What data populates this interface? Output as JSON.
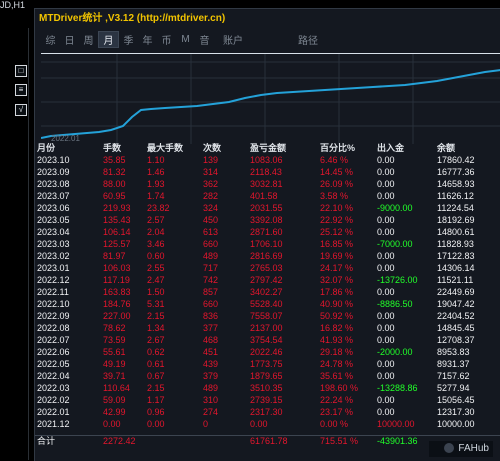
{
  "top": {
    "left_label": "JD,H1"
  },
  "window": {
    "title": "MTDriver统计 ,V3.12 (http://mtdriver.cn)",
    "tabs": [
      "综",
      "日",
      "周",
      "月",
      "季",
      "年",
      "币",
      "M",
      "音",
      "账户",
      "路径"
    ],
    "active_tab": "月"
  },
  "chart_label": {
    "date": "2022.01"
  },
  "table": {
    "headers": [
      "月份",
      "手数",
      "最大手数",
      "次数",
      "盈亏金额",
      "百分比%",
      "出入金",
      "余额"
    ],
    "rows": [
      [
        "2023.10",
        "35.85",
        "1.10",
        "139",
        "1083.06",
        "6.46 %",
        "0.00",
        "17860.42"
      ],
      [
        "2023.09",
        "81.32",
        "1.46",
        "314",
        "2118.43",
        "14.45 %",
        "0.00",
        "16777.36"
      ],
      [
        "2023.08",
        "88.00",
        "1.93",
        "362",
        "3032.81",
        "26.09 %",
        "0.00",
        "14658.93"
      ],
      [
        "2023.07",
        "60.95",
        "1.74",
        "282",
        "401.58",
        "3.58 %",
        "0.00",
        "11626.12"
      ],
      [
        "2023.06",
        "219.93",
        "23.82",
        "324",
        "2031.55",
        "22.10 %",
        "-9000.00",
        "11224.54"
      ],
      [
        "2023.05",
        "135.43",
        "2.57",
        "450",
        "3392.08",
        "22.92 %",
        "0.00",
        "18192.69"
      ],
      [
        "2023.04",
        "106.14",
        "2.04",
        "613",
        "2871.60",
        "25.12 %",
        "0.00",
        "14800.61"
      ],
      [
        "2023.03",
        "125.57",
        "3.46",
        "660",
        "1706.10",
        "16.85 %",
        "-7000.00",
        "11828.93"
      ],
      [
        "2023.02",
        "81.97",
        "0.60",
        "489",
        "2816.69",
        "19.69 %",
        "0.00",
        "17122.83"
      ],
      [
        "2023.01",
        "106.03",
        "2.55",
        "717",
        "2765.03",
        "24.17 %",
        "0.00",
        "14306.14"
      ],
      [
        "2022.12",
        "117.19",
        "2.47",
        "742",
        "2797.42",
        "32.07 %",
        "-13726.00",
        "11521.11"
      ],
      [
        "2022.11",
        "163.83",
        "1.50",
        "857",
        "3402.27",
        "17.86 %",
        "0.00",
        "22449.69"
      ],
      [
        "2022.10",
        "184.76",
        "5.31",
        "660",
        "5528.40",
        "40.90 %",
        "-8886.50",
        "19047.42"
      ],
      [
        "2022.09",
        "227.00",
        "2.15",
        "836",
        "7558.07",
        "50.92 %",
        "0.00",
        "22404.52"
      ],
      [
        "2022.08",
        "78.62",
        "1.34",
        "377",
        "2137.00",
        "16.82 %",
        "0.00",
        "14845.45"
      ],
      [
        "2022.07",
        "73.59",
        "2.67",
        "468",
        "3754.54",
        "41.93 %",
        "0.00",
        "12708.37"
      ],
      [
        "2022.06",
        "55.61",
        "0.62",
        "451",
        "2022.46",
        "29.18 %",
        "-2000.00",
        "8953.83"
      ],
      [
        "2022.05",
        "49.19",
        "0.61",
        "439",
        "1773.75",
        "24.78 %",
        "0.00",
        "8931.37"
      ],
      [
        "2022.04",
        "39.71",
        "0.67",
        "379",
        "1879.65",
        "35.61 %",
        "0.00",
        "7157.62"
      ],
      [
        "2022.03",
        "110.64",
        "2.15",
        "489",
        "3510.35",
        "198.60 %",
        "-13288.86",
        "5277.94"
      ],
      [
        "2022.02",
        "59.09",
        "1.17",
        "310",
        "2739.15",
        "22.24 %",
        "0.00",
        "15056.45"
      ],
      [
        "2022.01",
        "42.99",
        "0.96",
        "274",
        "2317.30",
        "23.17 %",
        "0.00",
        "12317.30"
      ],
      [
        "2021.12",
        "0.00",
        "0.00",
        "0",
        "0.00",
        "0.00 %",
        "10000.00",
        "10000.00"
      ]
    ],
    "total": [
      "合计",
      "2272.42",
      "",
      "",
      "61761.78",
      "715.51 %",
      "-43901.36",
      ""
    ]
  },
  "badge": {
    "text": "FAHub"
  },
  "colors": {
    "positive": "#e4162d",
    "negative": "#21ff2a",
    "title": "#f2c400"
  }
}
